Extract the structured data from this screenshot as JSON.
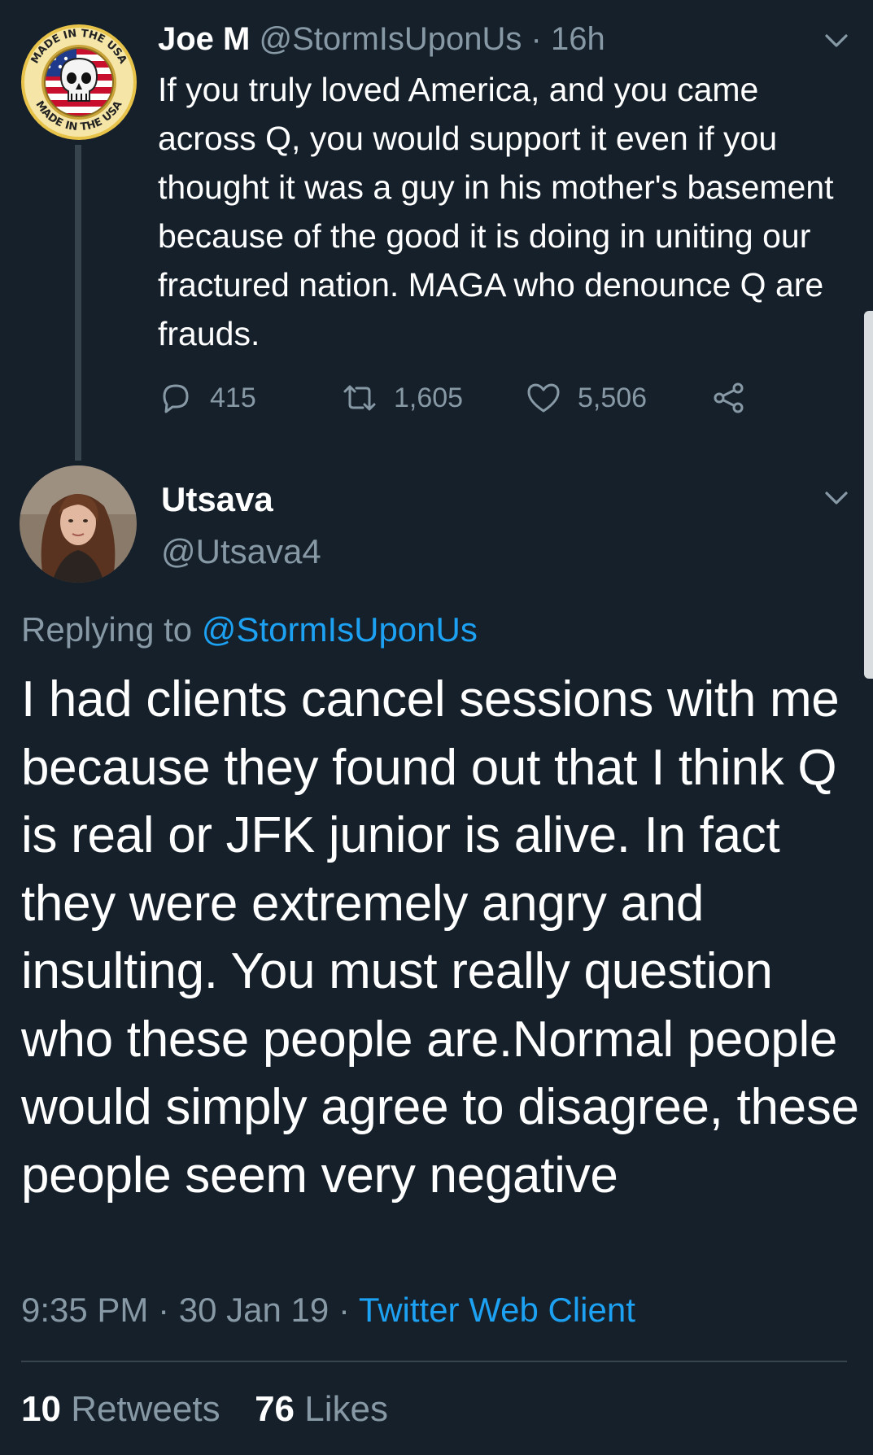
{
  "parent_tweet": {
    "avatar": {
      "icon": "skull-flag-seal-icon",
      "seal_text": "MADE IN THE USA"
    },
    "author_name": "Joe M",
    "handle": "@StormIsUponUs",
    "separator": "·",
    "time": "16h",
    "body": "If you truly loved America, and you came across Q, you would support it even if you thought it was a guy in his mother's basement because of the good it is doing in uniting our fractured nation. MAGA who denounce Q are frauds.",
    "actions": {
      "replies": "415",
      "retweets": "1,605",
      "likes": "5,506"
    }
  },
  "focused_tweet": {
    "author_name": "Utsava",
    "handle": "@Utsava4",
    "replying_prefix": "Replying to",
    "replying_handle": "@StormIsUponUs",
    "body": "I had clients cancel sessions with me because they found out that I think Q is real or JFK junior is alive. In fact they were extremely angry and insulting. You must really question who these people are.Normal people would simply agree to disagree, these people seem very negative",
    "time": "9:35 PM",
    "date": "30 Jan 19",
    "separator": "·",
    "source": "Twitter Web Client",
    "retweets_count": "10",
    "retweets_label": "Retweets",
    "likes_count": "76",
    "likes_label": "Likes"
  },
  "colors": {
    "background": "#15202b",
    "text_primary": "#ffffff",
    "text_secondary": "#8899a6",
    "link": "#1da1f2",
    "divider": "#38444d"
  }
}
